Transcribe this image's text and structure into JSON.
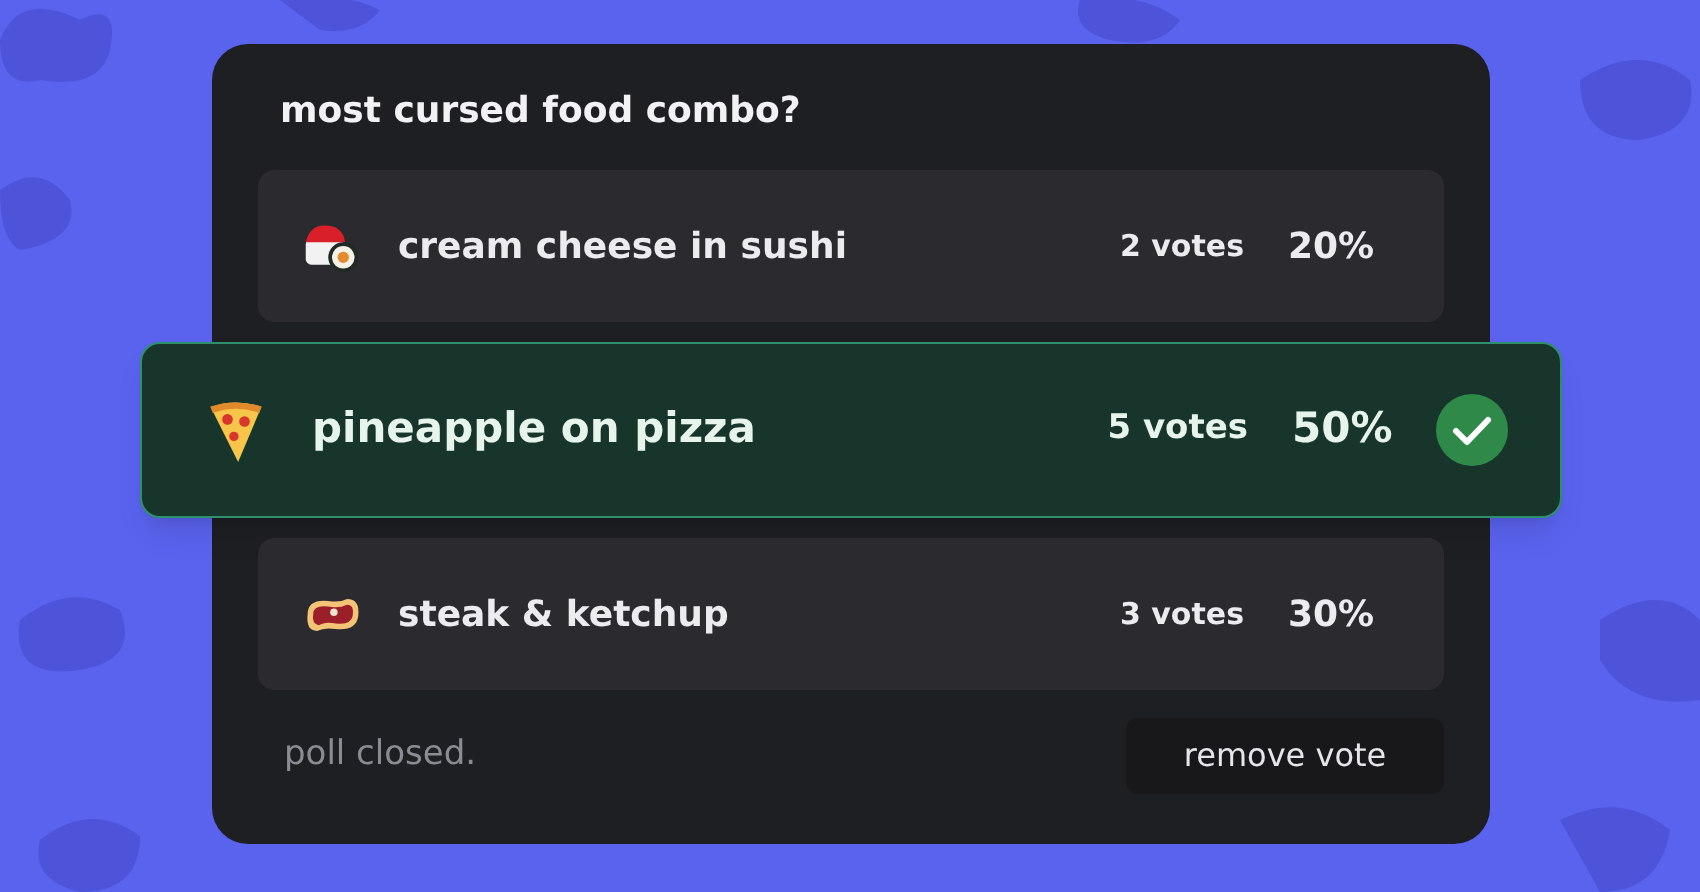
{
  "poll": {
    "question": "most cursed food combo?",
    "options": [
      {
        "kind": "sushi",
        "label": "cream cheese in sushi",
        "votes": "2 votes",
        "percent": "20%",
        "selected": false
      },
      {
        "kind": "pizza",
        "label": "pineapple on pizza",
        "votes": "5 votes",
        "percent": "50%",
        "selected": true
      },
      {
        "kind": "steak",
        "label": "steak & ketchup",
        "votes": "3 votes",
        "percent": "30%",
        "selected": false
      }
    ],
    "status": "poll closed.",
    "button": "remove vote"
  }
}
